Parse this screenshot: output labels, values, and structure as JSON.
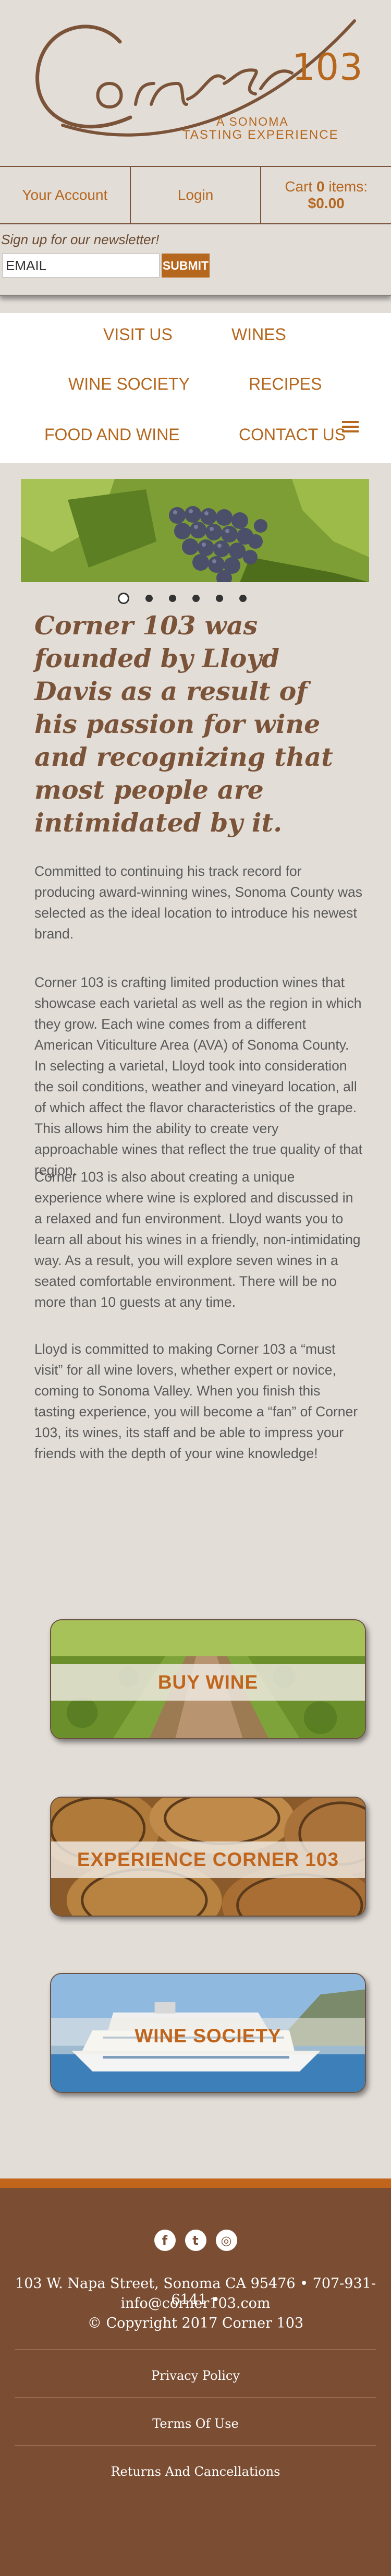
{
  "logo": {
    "script_text": "Corner",
    "number": "103",
    "line1": "A SONOMA",
    "line2": "TASTING EXPERIENCE"
  },
  "account_bar": {
    "account_label": "Your Account",
    "login_label": "Login",
    "cart_prefix": "Cart",
    "cart_count": "0",
    "cart_suffix": "items:",
    "cart_total": "$0.00"
  },
  "newsletter": {
    "label": "Sign up for our newsletter!",
    "placeholder": "EMAIL",
    "submit_label": "SUBMIT"
  },
  "nav": {
    "items": [
      "VISIT US",
      "WINES",
      "WINE SOCIETY",
      "RECIPES",
      "FOOD AND WINE",
      "CONTACT US"
    ]
  },
  "slider": {
    "slide_count": 6,
    "active_slide": 1
  },
  "headline": "Corner 103 was founded by Lloyd Davis as a result of his passion for wine and recognizing that most people are intimidated by it.",
  "paragraphs": [
    "Committed to continuing his track record for producing award-winning wines, Sonoma County was selected as the ideal location to introduce his newest brand.",
    "Corner 103 is crafting limited production wines that showcase each varietal as well as the region in which they grow. Each wine comes from a different American Viticulture Area (AVA) of Sonoma County. In selecting a varietal, Lloyd took into consideration the soil conditions, weather and vineyard location, all of which affect the flavor characteristics of the grape. This allows him the ability to create very approachable wines that reflect the true quality of that region.",
    "Corner 103 is also about creating a unique experience where wine is explored and discussed in a relaxed and fun environment. Lloyd wants you to learn all about his wines in a friendly, non-intimidating way. As a result, you will explore seven wines in a seated comfortable environment. There will be no more than 10 guests at any time.",
    "Lloyd is committed to making Corner 103 a “must visit” for all wine lovers, whether expert or novice, coming to Sonoma Valley. When you finish this tasting experience, you will become a “fan” of Corner 103, its wines, its staff and be able to impress your friends with the depth of your wine knowledge!"
  ],
  "cta_buttons": [
    {
      "label": "BUY WINE",
      "image": "vineyard-rows"
    },
    {
      "label": "EXPERIENCE CORNER 103",
      "image": "wine-barrels"
    },
    {
      "label": "WINE SOCIETY",
      "image": "cruise-ship"
    }
  ],
  "footer": {
    "social": [
      {
        "icon": "facebook-icon",
        "glyph": "f"
      },
      {
        "icon": "twitter-icon",
        "glyph": "t"
      },
      {
        "icon": "instagram-icon",
        "glyph": "◎"
      }
    ],
    "address_line": "103 W. Napa Street, Sonoma CA 95476 • 707-931-6141 •",
    "email": "info@corner103.com",
    "copyright": "© Copyright 2017 Corner 103",
    "links": [
      "Privacy Policy",
      "Terms Of Use",
      "Returns And Cancellations"
    ]
  },
  "colors": {
    "background": "#e3ddd8",
    "accent": "#b5671e",
    "brown": "#7a5338",
    "footer": "#7b4e34",
    "footer_top_stripe": "#c0651b"
  }
}
